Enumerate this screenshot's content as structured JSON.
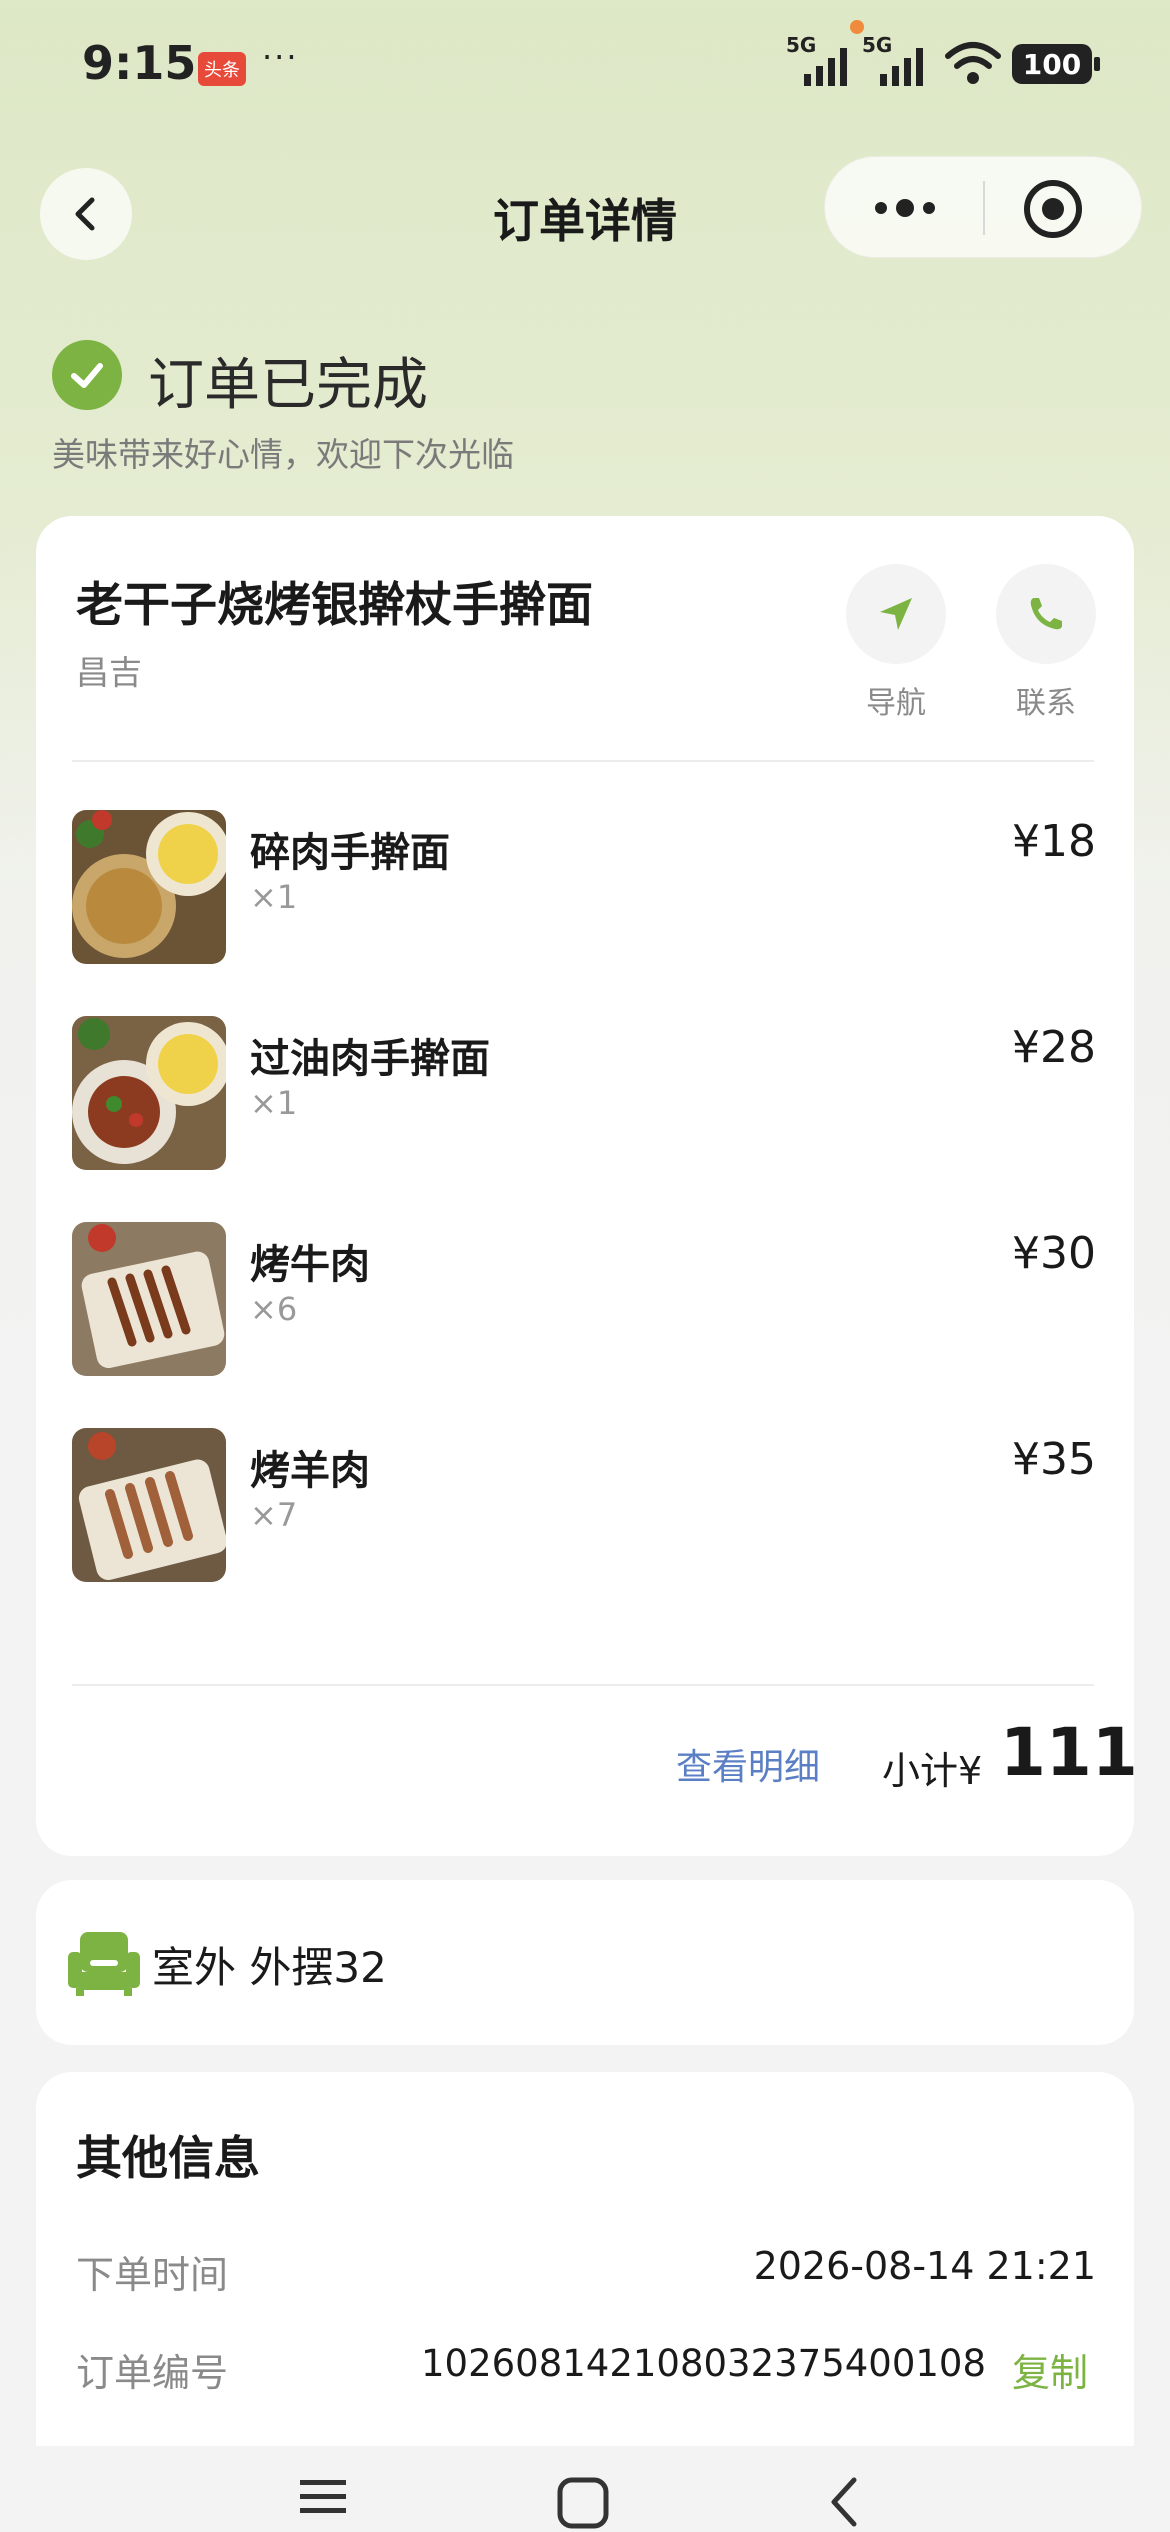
{
  "status_bar": {
    "time": "9:15",
    "app_badge": "头条",
    "more": "···",
    "signal_1": "5G",
    "signal_2": "5G",
    "battery": "100"
  },
  "nav": {
    "title": "订单详情"
  },
  "order_status": {
    "title": "订单已完成",
    "subtitle": "美味带来好心情，欢迎下次光临"
  },
  "store": {
    "name": "老干子烧烤银擀杖手擀面",
    "city": "昌吉",
    "nav_label": "导航",
    "contact_label": "联系"
  },
  "items": [
    {
      "name": "碎肉手擀面",
      "qty": "×1",
      "price": "¥18"
    },
    {
      "name": "过油肉手擀面",
      "qty": "×1",
      "price": "¥28"
    },
    {
      "name": "烤牛肉",
      "qty": "×6",
      "price": "¥30"
    },
    {
      "name": "烤羊肉",
      "qty": "×7",
      "price": "¥35"
    }
  ],
  "summary": {
    "detail_link": "查看明细",
    "subtotal_label": "小计¥",
    "subtotal_value": "111"
  },
  "seat": {
    "text": "室外 外摆32"
  },
  "other_info": {
    "title": "其他信息",
    "order_time_label": "下单时间",
    "order_time_value": "2026-08-14 21:21",
    "order_no_label": "订单编号",
    "order_no_value": "1026081421080323754001​08",
    "copy_label": "复制"
  },
  "colors": {
    "accent_green": "#7cb342",
    "link_blue": "#5b7fc4"
  }
}
